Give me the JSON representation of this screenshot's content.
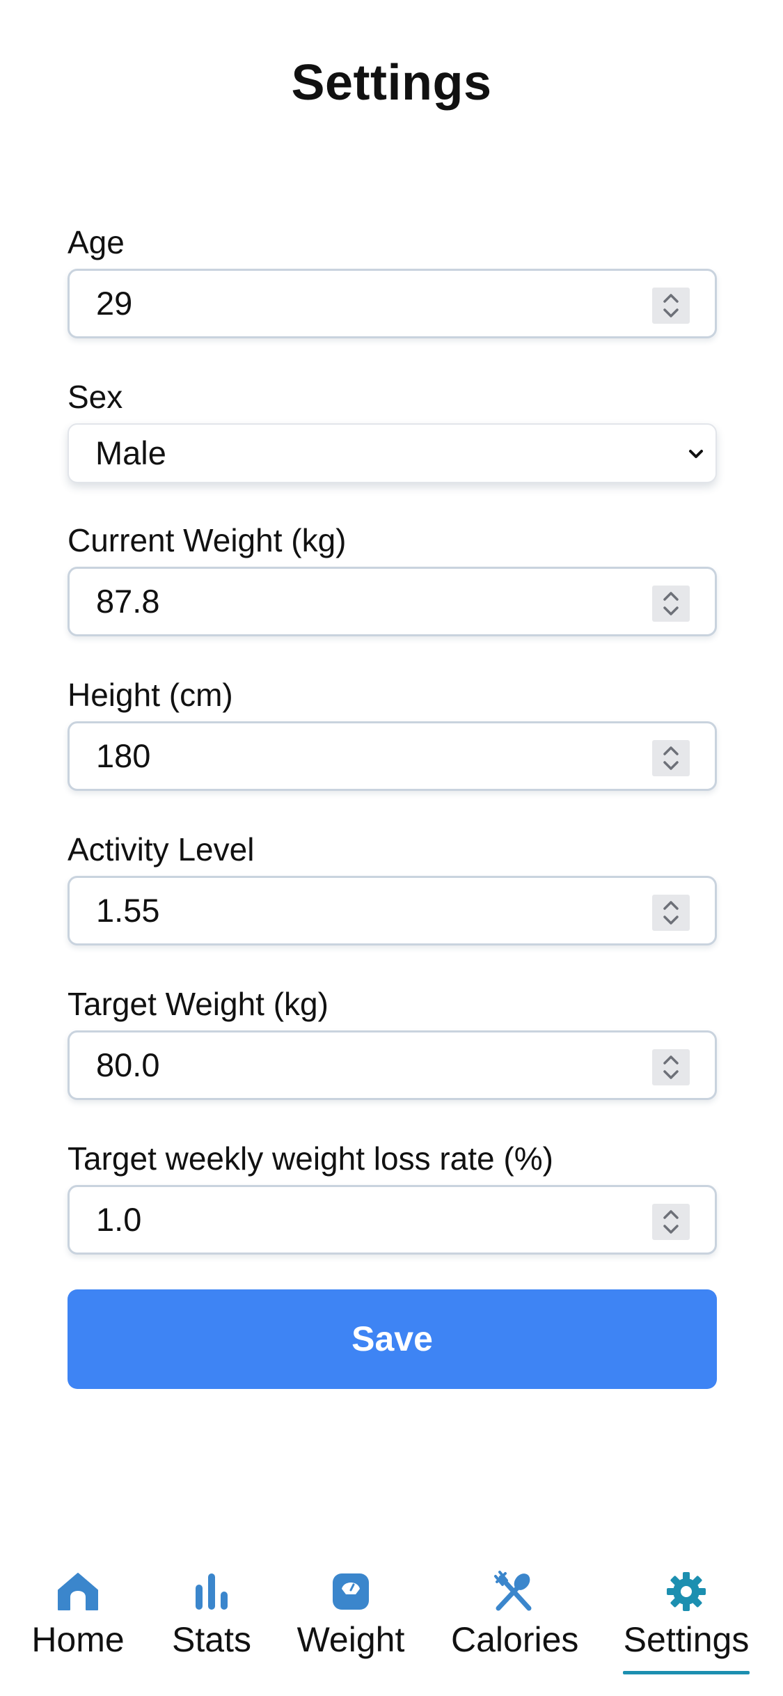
{
  "header": {
    "title": "Settings"
  },
  "form": {
    "age": {
      "label": "Age",
      "value": "29"
    },
    "sex": {
      "label": "Sex",
      "value": "Male"
    },
    "current_weight": {
      "label": "Current Weight (kg)",
      "value": "87.8"
    },
    "height": {
      "label": "Height (cm)",
      "value": "180"
    },
    "activity_level": {
      "label": "Activity Level",
      "value": "1.55"
    },
    "target_weight": {
      "label": "Target Weight (kg)",
      "value": "80.0"
    },
    "weekly_loss_rate": {
      "label": "Target weekly weight loss rate (%)",
      "value": "1.0"
    },
    "save_label": "Save"
  },
  "tabbar": {
    "tabs": [
      {
        "label": "Home",
        "icon": "home-icon"
      },
      {
        "label": "Stats",
        "icon": "bar-chart-icon"
      },
      {
        "label": "Weight",
        "icon": "scale-icon"
      },
      {
        "label": "Calories",
        "icon": "fork-spoon-icon"
      },
      {
        "label": "Settings",
        "icon": "gear-icon"
      }
    ],
    "active_tab": "Settings"
  },
  "colors": {
    "accent": "#3e84f4",
    "tab_icon": "#3b86cc",
    "tab_active": "#1c8fb0"
  }
}
